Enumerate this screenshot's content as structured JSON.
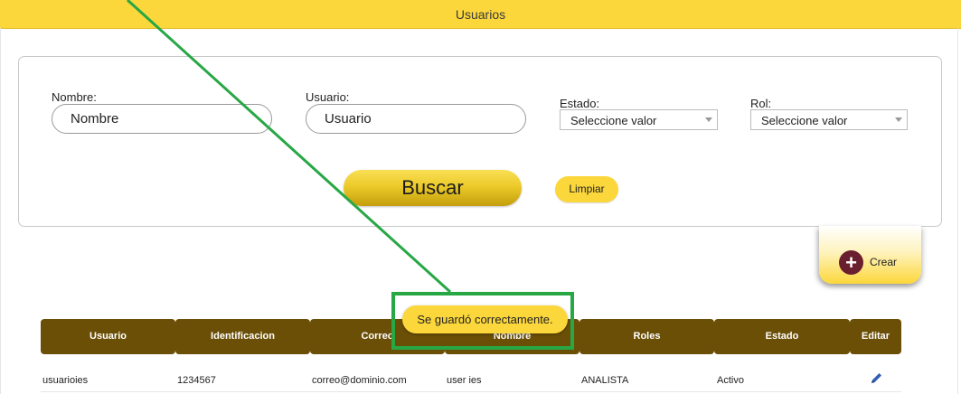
{
  "header": {
    "title": "Usuarios"
  },
  "filters": {
    "nombre": {
      "label": "Nombre:",
      "placeholder": "Nombre"
    },
    "usuario": {
      "label": "Usuario:",
      "placeholder": "Usuario"
    },
    "estado": {
      "label": "Estado:",
      "selected": "Seleccione valor"
    },
    "rol": {
      "label": "Rol:",
      "selected": "Seleccione valor"
    },
    "buscar_label": "Buscar",
    "limpiar_label": "Limpiar"
  },
  "crear": {
    "label": "Crear",
    "icon": "plus-circle-icon"
  },
  "toast": {
    "message": "Se guardó correctamente."
  },
  "table": {
    "columns": [
      "Usuario",
      "Identificacion",
      "Correo",
      "Nombre",
      "Roles",
      "Estado",
      "Editar"
    ],
    "rows": [
      {
        "usuario": "usuarioies",
        "identificacion": "1234567",
        "correo": "correo@dominio.com",
        "nombre": "user ies",
        "roles": "ANALISTA",
        "estado": "Activo",
        "editar_icon": "pencil-icon"
      }
    ]
  },
  "colors": {
    "accent": "#fcd73b",
    "table_header": "#6b4f07",
    "crear_icon": "#6a1f2e",
    "annotation": "#28a745"
  }
}
